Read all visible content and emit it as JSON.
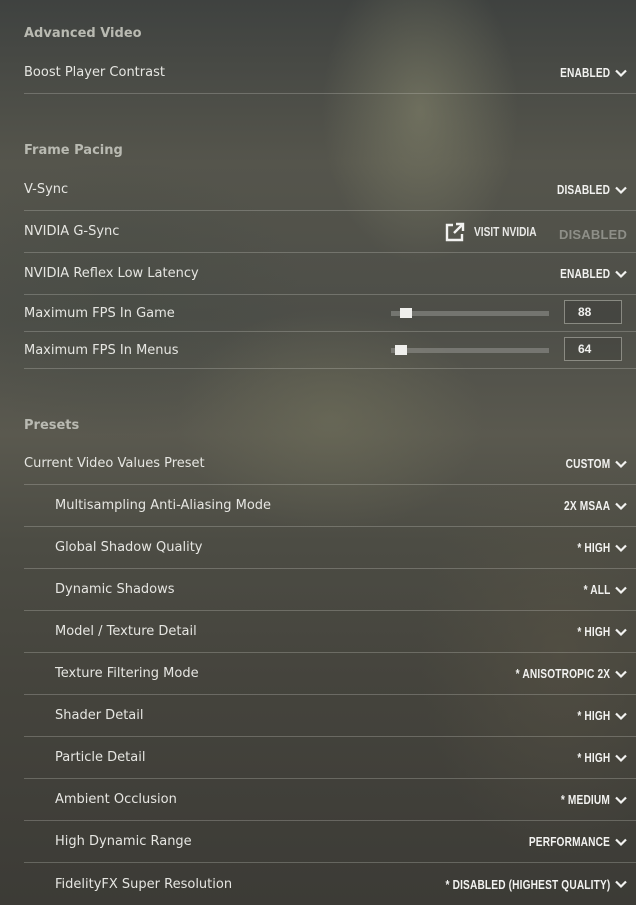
{
  "sections": {
    "advanced_video": "Advanced Video",
    "frame_pacing": "Frame Pacing",
    "presets": "Presets"
  },
  "rows": {
    "boost_player_contrast": {
      "label": "Boost Player Contrast",
      "value": "ENABLED"
    },
    "vsync": {
      "label": "V-Sync",
      "value": "DISABLED"
    },
    "gsync": {
      "label": "NVIDIA G-Sync",
      "link": "VISIT NVIDIA",
      "value": "DISABLED"
    },
    "reflex": {
      "label": "NVIDIA Reflex Low Latency",
      "value": "ENABLED"
    },
    "max_fps_game": {
      "label": "Maximum FPS In Game",
      "value": "88",
      "fraction": 0.06
    },
    "max_fps_menus": {
      "label": "Maximum FPS In Menus",
      "value": "64",
      "fraction": 0.03
    },
    "video_preset": {
      "label": "Current Video Values Preset",
      "value": "CUSTOM"
    },
    "msaa": {
      "label": "Multisampling Anti-Aliasing Mode",
      "value": "2X MSAA"
    },
    "shadow_quality": {
      "label": "Global Shadow Quality",
      "value": "* HIGH"
    },
    "dynamic_shadows": {
      "label": "Dynamic Shadows",
      "value": "* ALL"
    },
    "model_texture": {
      "label": "Model / Texture Detail",
      "value": "* HIGH"
    },
    "texture_filtering": {
      "label": "Texture Filtering Mode",
      "value": "* ANISOTROPIC 2X"
    },
    "shader_detail": {
      "label": "Shader Detail",
      "value": "* HIGH"
    },
    "particle_detail": {
      "label": "Particle Detail",
      "value": "* HIGH"
    },
    "ambient_occlusion": {
      "label": "Ambient Occlusion",
      "value": "* MEDIUM"
    },
    "hdr": {
      "label": "High Dynamic Range",
      "value": "PERFORMANCE"
    },
    "fsr": {
      "label": "FidelityFX Super Resolution",
      "value": "* DISABLED (HIGHEST QUALITY)"
    }
  },
  "icons": {
    "dropdown": "chevron-down-icon",
    "external_link": "external-link-icon"
  },
  "colors": {
    "text": "#e6e6e2",
    "section": "#b9bab2",
    "disabled": "#8e8f88"
  }
}
